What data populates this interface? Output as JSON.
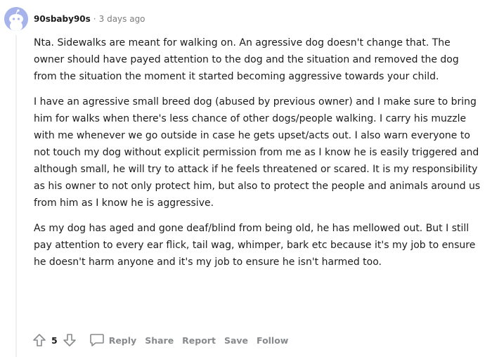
{
  "comment": {
    "author": "90sbaby90s",
    "separator": "·",
    "time": "3 days ago",
    "paragraphs": [
      "Nta. Sidewalks are meant for walking on. An agressive dog doesn't change that. The owner should have payed attention to the dog and the situation and removed the dog from the situation the moment it started becoming aggressive towards your child.",
      "I have an agressive small breed dog (abused by previous owner) and I make sure to bring him for walks when there's less chance of other dogs/people walking. I carry his muzzle with me whenever we go outside in case he gets upset/acts out. I also warn everyone to not touch my dog without explicit permission from me as I know he is easily triggered and although small, he will try to attack if he feels threatened or scared. It is my responsibility as his owner to not only protect him, but also to protect the people and animals around us from him as I know he is aggressive.",
      "As my dog has aged and gone deaf/blind from being old, he has mellowed out. But I still pay attention to every ear flick, tail wag, whimper, bark etc because it's my job to ensure he doesn't harm anyone and it's my job to ensure he isn't harmed too."
    ],
    "score": "5"
  },
  "actions": {
    "reply": "Reply",
    "share": "Share",
    "report": "Report",
    "save": "Save",
    "follow": "Follow"
  },
  "icons": {
    "avatar": "reddit-snoo-avatar",
    "upvote": "upvote-arrow-icon",
    "downvote": "downvote-arrow-icon",
    "reply": "comment-bubble-icon"
  },
  "colors": {
    "avatar_bg": "#a7b4ec",
    "muted": "#878a8c",
    "text": "#1c1c1c"
  }
}
